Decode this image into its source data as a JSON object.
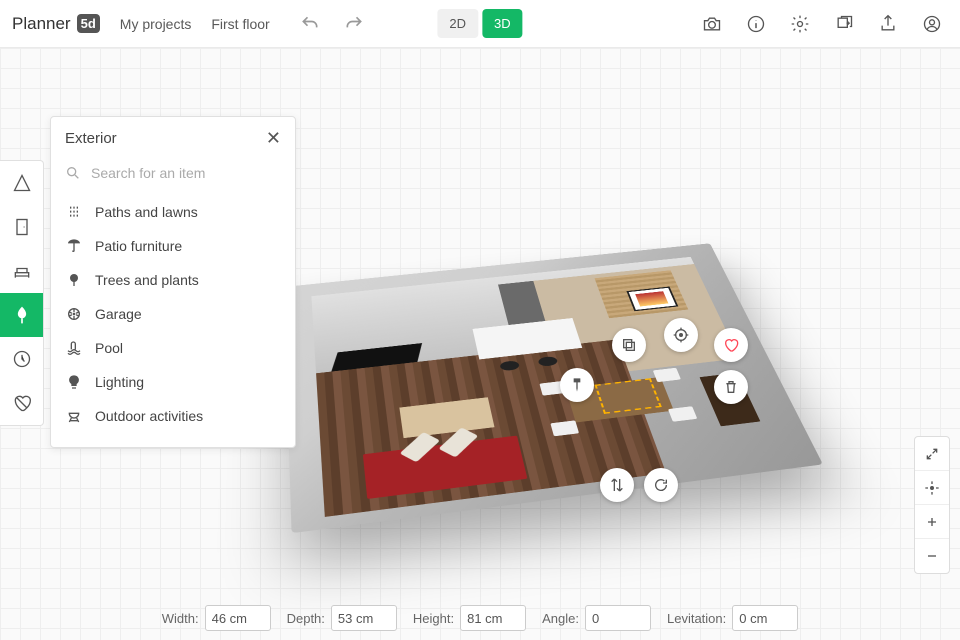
{
  "app": {
    "name": "Planner",
    "badge": "5d"
  },
  "nav": {
    "projects": "My projects",
    "floor": "First floor"
  },
  "view": {
    "d2": "2D",
    "d3": "3D",
    "active": "3D"
  },
  "panel": {
    "title": "Exterior",
    "search_placeholder": "Search for an item",
    "items": [
      {
        "label": "Paths and lawns",
        "icon": "path"
      },
      {
        "label": "Patio furniture",
        "icon": "umbrella"
      },
      {
        "label": "Trees and plants",
        "icon": "tree"
      },
      {
        "label": "Garage",
        "icon": "wheel"
      },
      {
        "label": "Pool",
        "icon": "pool"
      },
      {
        "label": "Lighting",
        "icon": "bulb"
      },
      {
        "label": "Outdoor activities",
        "icon": "bbq"
      }
    ]
  },
  "sidebar": [
    "construction",
    "doors",
    "furniture",
    "exterior",
    "history",
    "broken-heart"
  ],
  "dims": {
    "width": {
      "label": "Width:",
      "value": "46 cm"
    },
    "depth": {
      "label": "Depth:",
      "value": "53 cm"
    },
    "height": {
      "label": "Height:",
      "value": "81 cm"
    },
    "angle": {
      "label": "Angle:",
      "value": "0"
    },
    "lev": {
      "label": "Levitation:",
      "value": "0 cm"
    }
  },
  "colors": {
    "accent": "#14B866"
  }
}
